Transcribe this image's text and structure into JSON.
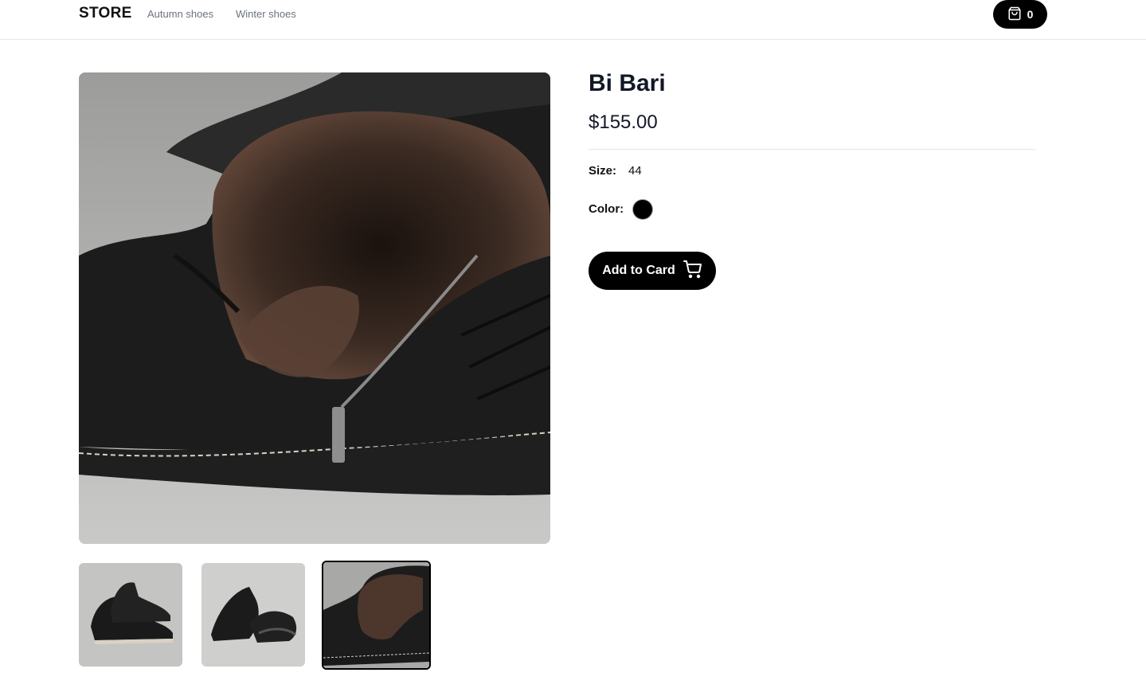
{
  "nav": {
    "logo": "STORE",
    "links": [
      "Autumn shoes",
      "Winter shoes"
    ],
    "cart_count": "0",
    "cart_icon": "shopping-bag-icon"
  },
  "product": {
    "name": "Bi Bari",
    "price": "$155.00",
    "size_label": "Size:",
    "size_value": "44",
    "color_label": "Color:",
    "color_value": "#000000",
    "add_button_label": "Add to Card",
    "add_button_icon": "cart-icon"
  },
  "gallery": {
    "selected_index": 2,
    "thumbnails": [
      "boot-pair-front",
      "boot-pair-side",
      "boot-interior-fur"
    ]
  }
}
